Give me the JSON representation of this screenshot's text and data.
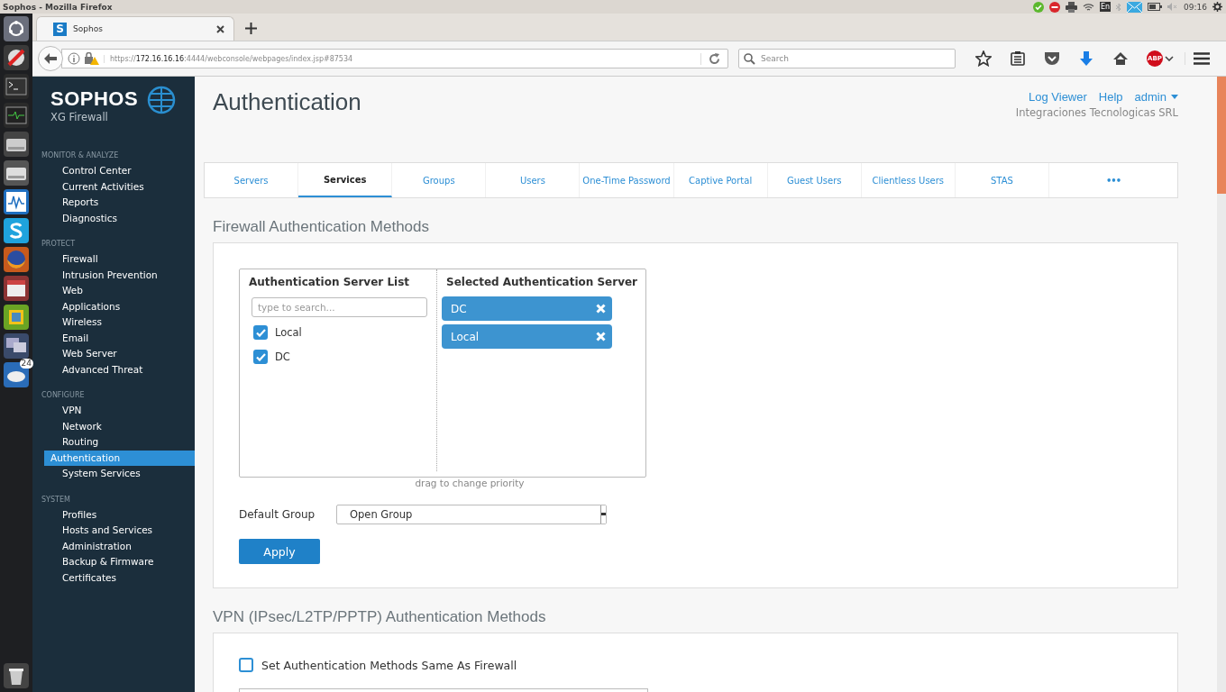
{
  "system_bar": {
    "title": "Sophos - Mozilla Firefox",
    "keyboard": "En",
    "clock": "09:16"
  },
  "launcher": {
    "badge": "24"
  },
  "browser": {
    "tab_title": "Sophos",
    "favicon_letter": "S",
    "url": {
      "scheme": "https://",
      "host": "172.16.16.16",
      "rest": ":4444/webconsole/webpages/index.jsp#87534"
    },
    "search_placeholder": "Search",
    "adblock_label": "ABP"
  },
  "sidebar": {
    "brand": "SOPHOS",
    "product": "XG Firewall",
    "sections": [
      {
        "title": "MONITOR & ANALYZE",
        "items": [
          {
            "label": "Control Center",
            "selected": false
          },
          {
            "label": "Current Activities",
            "selected": false
          },
          {
            "label": "Reports",
            "selected": false
          },
          {
            "label": "Diagnostics",
            "selected": false
          }
        ]
      },
      {
        "title": "PROTECT",
        "items": [
          {
            "label": "Firewall",
            "selected": false
          },
          {
            "label": "Intrusion Prevention",
            "selected": false
          },
          {
            "label": "Web",
            "selected": false
          },
          {
            "label": "Applications",
            "selected": false
          },
          {
            "label": "Wireless",
            "selected": false
          },
          {
            "label": "Email",
            "selected": false
          },
          {
            "label": "Web Server",
            "selected": false
          },
          {
            "label": "Advanced Threat",
            "selected": false
          }
        ]
      },
      {
        "title": "CONFIGURE",
        "items": [
          {
            "label": "VPN",
            "selected": false
          },
          {
            "label": "Network",
            "selected": false
          },
          {
            "label": "Routing",
            "selected": false
          },
          {
            "label": "Authentication",
            "selected": true
          },
          {
            "label": "System Services",
            "selected": false
          }
        ]
      },
      {
        "title": "SYSTEM",
        "items": [
          {
            "label": "Profiles",
            "selected": false
          },
          {
            "label": "Hosts and Services",
            "selected": false
          },
          {
            "label": "Administration",
            "selected": false
          },
          {
            "label": "Backup & Firmware",
            "selected": false
          },
          {
            "label": "Certificates",
            "selected": false
          }
        ]
      }
    ]
  },
  "header": {
    "title": "Authentication",
    "links": [
      "Log Viewer",
      "Help",
      "admin"
    ],
    "organization": "Integraciones Tecnologicas SRL"
  },
  "tabs": [
    {
      "label": "Servers",
      "selected": false
    },
    {
      "label": "Services",
      "selected": true
    },
    {
      "label": "Groups",
      "selected": false
    },
    {
      "label": "Users",
      "selected": false
    },
    {
      "label": "One-Time Password",
      "selected": false
    },
    {
      "label": "Captive Portal",
      "selected": false
    },
    {
      "label": "Guest Users",
      "selected": false
    },
    {
      "label": "Clientless Users",
      "selected": false
    },
    {
      "label": "STAS",
      "selected": false
    }
  ],
  "tabs_more": "•••",
  "firewall_methods": {
    "title": "Firewall Authentication Methods",
    "server_list": {
      "title": "Authentication Server List",
      "placeholder": "type to search...",
      "items": [
        {
          "label": "Local",
          "checked": true
        },
        {
          "label": "DC",
          "checked": true
        }
      ]
    },
    "selected_servers": {
      "title": "Selected Authentication Server",
      "items": [
        {
          "label": "DC"
        },
        {
          "label": "Local"
        }
      ]
    },
    "hint": "drag to change priority",
    "default_group": {
      "label": "Default Group",
      "value": "Open Group"
    },
    "apply": "Apply"
  },
  "vpn_methods": {
    "title": "VPN (IPsec/L2TP/PPTP) Authentication Methods",
    "same_as_firewall": {
      "label": "Set Authentication Methods Same As Firewall",
      "checked": false
    }
  }
}
